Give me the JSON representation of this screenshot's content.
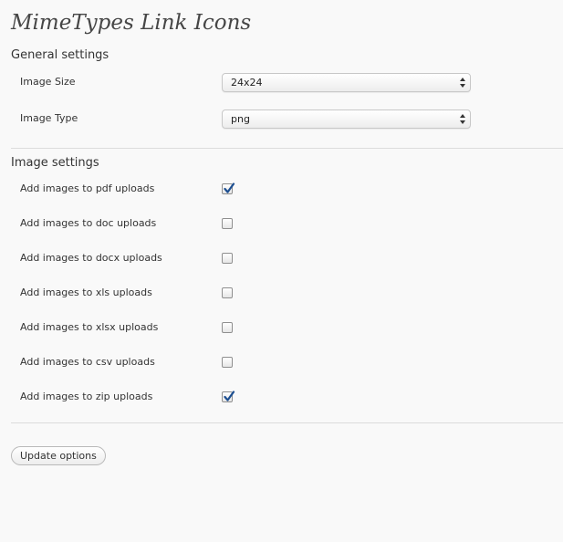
{
  "page": {
    "title": "MimeTypes Link Icons"
  },
  "general_settings": {
    "heading": "General settings",
    "fields": [
      {
        "label": "Image Size",
        "value": "24x24"
      },
      {
        "label": "Image Type",
        "value": "png"
      }
    ]
  },
  "image_settings": {
    "heading": "Image settings",
    "items": [
      {
        "label": "Add images to pdf uploads",
        "checked": true
      },
      {
        "label": "Add images to doc uploads",
        "checked": false
      },
      {
        "label": "Add images to docx uploads",
        "checked": false
      },
      {
        "label": "Add images to xls uploads",
        "checked": false
      },
      {
        "label": "Add images to xlsx uploads",
        "checked": false
      },
      {
        "label": "Add images to csv uploads",
        "checked": false
      },
      {
        "label": "Add images to zip uploads",
        "checked": true
      }
    ]
  },
  "actions": {
    "update_label": "Update options"
  },
  "colors": {
    "checkmark": "#1d4f91",
    "background": "#f9f9f9"
  }
}
